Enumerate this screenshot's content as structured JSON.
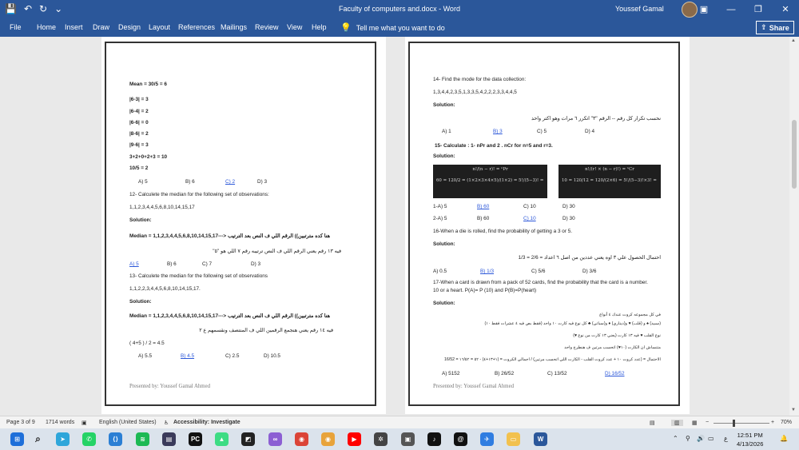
{
  "titlebar": {
    "document_title": "Faculty of computers and.docx  -  Word",
    "user_name": "Youssef Gamal",
    "qat_icons": [
      "save-icon",
      "undo-icon",
      "redo-icon",
      "customize-icon"
    ],
    "minimize": "—",
    "restore": "❐",
    "close": "✕",
    "ribbon_display": "▣"
  },
  "ribbon": {
    "tabs": [
      "File",
      "Home",
      "Insert",
      "Draw",
      "Design",
      "Layout",
      "References",
      "Mailings",
      "Review",
      "View",
      "Help"
    ],
    "tell_me": "Tell me what you want to do",
    "share": "Share"
  },
  "left_page": {
    "lines": [
      "Mean = 30/5 = 6",
      "|6-3| = 3",
      "|6-4| = 2",
      "|6-6| = 0",
      "|8-6| = 2",
      "|9-6| = 3",
      "3+2+0+2+3 = 10",
      "10/5 = 2"
    ],
    "q11_options": [
      "A)   5",
      "B) 6",
      "C) 2",
      "D) 3"
    ],
    "q12": "12- Calculete the median for the following set of observations:",
    "q12_data": "1,1,2,3,4,4,5,6,8,10,14,15,17",
    "solution": "Solution:",
    "q12_median": "Median = ‏هنا كده مترتبين)) الرقم اللي ف النص بعد الترتيب <---1,1,2,3,4,4,5,6,8,10,14,15,17",
    "q12_note": "فيه ١٣ رقم يعني الرقم اللي ف النص ترتيبه رقم ٧ اللي هو \"٥\"",
    "q12_options": [
      "A) 5",
      "B) 6",
      "C) 7",
      "D) 3"
    ],
    "q13": "13- Calculete the median for the following set of observations",
    "q13_data": "1,1,2,2,3,4,4,5,6,8,10,14,15,17.",
    "q13_median": "Median = ‏هنا كده مترتبين)) الرقم اللي ف النص بعد الترتيب <---1,1,2,3,4,4,5,6,8,10,14,15,17",
    "q13_note": "فيه ١٤ رقم يعني هنجمع الرقمين اللي ف المنتصف ونقسمهم ع ٢",
    "q13_calc": "( 4+5 ) / 2 = 4.5",
    "q13_options": [
      "A)   5.5",
      "B) 4.5",
      "C) 2.5",
      "D) 10.5"
    ],
    "footer": "Presented by: Youssef Gamal Ahmed"
  },
  "right_page": {
    "q14": "14- Find the mode for the data collection:",
    "q14_data": "1,3,4,4,2,3,5,1,3,3,5,4,2,2,2,3,3,4,4,5",
    "solution": "Solution:",
    "q14_note": "نحسب تكرار كل رقم -- الرقم \"٣\" اتكرر ٦ مرات وهو اكتر واحد",
    "q14_options": [
      "A)   1",
      "B) 3",
      "C) 5",
      "D) 4"
    ],
    "q15": "15- Calculate : 1-  nPr and   2 . nCr    for n=5  and r=3.",
    "eq_left_top": "n!/(n − r)! = ⁿPr",
    "eq_left_bottom": "60 = 120/2 = (1×2×3×4×5)/(1×2) = 5!/(5−3)! = ⁵P₃",
    "eq_right_top": "n!/(r! × (n − r)!) = ⁿCr",
    "eq_right_bottom": "10 = 120/12 = 120/(2×6) = 5!/(5−3)!×3! = ⁵C₃",
    "q15_1_options": [
      "1-A) 5",
      "B) 60",
      "C) 10",
      "D) 30"
    ],
    "q15_2_options": [
      "2-A) 5",
      "B) 60",
      "C) 10",
      "D) 30"
    ],
    "q16": "16-When a die is rolled, find the probability of getting a 3 or 5.",
    "q16_note": "احتمال الحصول علي ٣ اوه يعني عددين من اصل ٦ اعداد = 2/6 = 1/3",
    "q16_options": [
      "A) 0.5",
      "B) 1/3",
      "C) 5/6",
      "D) 3/6"
    ],
    "q17": "17-When a card is drawn from a pack of 52 cards, find the probability that the card is a number.",
    "q17_b": "10 or a heart. P(A)= P (10) and P(B)=P(heart)",
    "q17_ar1": "في كل مجموعه كروت عندك ٤ أنواع",
    "q17_ar2": "(سبيد) ♠ و (قلب) ♥ و(ديناري) ♦ و(سباتي) ♣ كل نوع فيه كارت ١٠ واحد (فقط بص فيه ٤ عشرات فقط ١٠)",
    "q17_ar3": "نوع القلب ♥ فيه ١٣ كارت (يعني ١٣ كارت من نوع ♥)",
    "q17_ar4": "متنساش ان الكارت (١٠♥) اتحسب مرتين ف هنطرح واحد",
    "q17_ar5": "الاحتمال = (عدد كروت ١٠ + عدد كروت القلب - الكارت اللي اتحسب مرتين) / اجمالي الكروت = (١+١٣+٤) - ٥٢ = ١٦/٥٢ = 16/52",
    "q17_options": [
      "A)  5152",
      "B) 26/52",
      "C) 13/52",
      "D) 16/52"
    ],
    "footer": "Presented by: Youssef Gamal Ahmed"
  },
  "status": {
    "page": "Page 3 of 9",
    "words": "1714 words",
    "language": "English (United States)",
    "accessibility": "Accessibility: Investigate",
    "zoom": "70%"
  },
  "taskbar": {
    "time": "12:51 PM",
    "date": "4/13/2026",
    "lang": "ع",
    "apps": [
      {
        "name": "telegram-icon",
        "color": "#2ea6da",
        "glyph": "➤"
      },
      {
        "name": "whatsapp-icon",
        "color": "#25d366",
        "glyph": "✆"
      },
      {
        "name": "vscode-icon",
        "color": "#2b7fd4",
        "glyph": "⟨⟩"
      },
      {
        "name": "spotify-icon",
        "color": "#1db954",
        "glyph": "≋"
      },
      {
        "name": "app-icon-dark",
        "color": "#3a3a5a",
        "glyph": "▤"
      },
      {
        "name": "pycharm-icon",
        "color": "#111111",
        "glyph": "PC"
      },
      {
        "name": "android-studio-icon",
        "color": "#3ddc84",
        "glyph": "▲"
      },
      {
        "name": "cursor-icon",
        "color": "#222222",
        "glyph": "◩"
      },
      {
        "name": "visual-studio-icon",
        "color": "#8c5fd3",
        "glyph": "∞"
      },
      {
        "name": "chrome-icon",
        "color": "#db4437",
        "glyph": "◉"
      },
      {
        "name": "chrome-alt-icon",
        "color": "#e8a33a",
        "glyph": "◉"
      },
      {
        "name": "youtube-icon",
        "color": "#ff0000",
        "glyph": "▶"
      },
      {
        "name": "chatgpt-icon",
        "color": "#444444",
        "glyph": "✲"
      },
      {
        "name": "app-icon-gray",
        "color": "#555555",
        "glyph": "▣"
      },
      {
        "name": "tiktok-icon",
        "color": "#111111",
        "glyph": "♪"
      },
      {
        "name": "threads-icon",
        "color": "#111111",
        "glyph": "@"
      },
      {
        "name": "vpn-icon",
        "color": "#2f7de1",
        "glyph": "✈"
      },
      {
        "name": "file-explorer-icon",
        "color": "#f2c14e",
        "glyph": "▭"
      },
      {
        "name": "word-icon",
        "color": "#2b579a",
        "glyph": "W"
      }
    ]
  }
}
